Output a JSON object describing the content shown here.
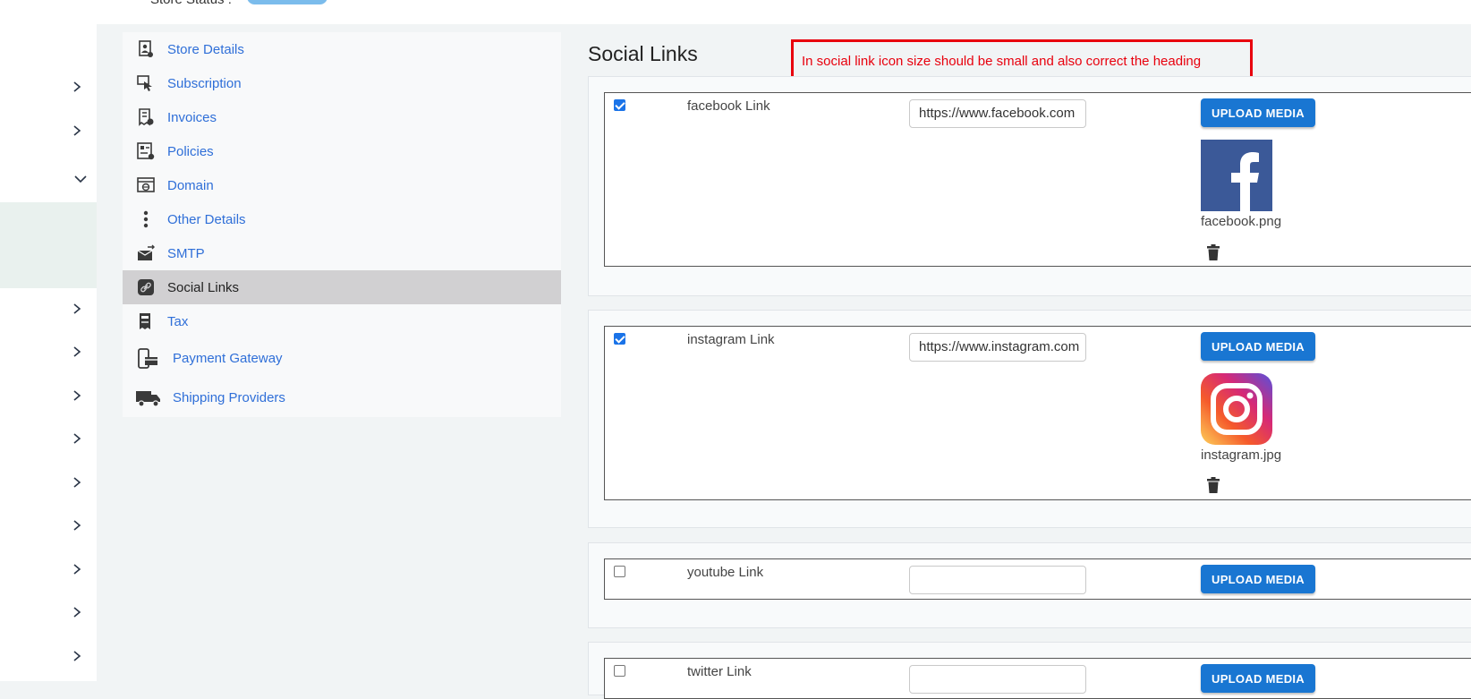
{
  "header": {
    "store_status_label": "Store Status :"
  },
  "settings_menu": {
    "items": [
      {
        "label": "Store Details",
        "icon": "store-details-icon",
        "active": false
      },
      {
        "label": "Subscription",
        "icon": "subscription-icon",
        "active": false
      },
      {
        "label": "Invoices",
        "icon": "invoices-icon",
        "active": false
      },
      {
        "label": "Policies",
        "icon": "policies-icon",
        "active": false
      },
      {
        "label": "Domain",
        "icon": "domain-icon",
        "active": false
      },
      {
        "label": "Other Details",
        "icon": "more-vertical-icon",
        "active": false
      },
      {
        "label": "SMTP",
        "icon": "smtp-mail-icon",
        "active": false
      },
      {
        "label": "Social Links",
        "icon": "link-icon",
        "active": true
      },
      {
        "label": "Tax",
        "icon": "tax-receipt-icon",
        "active": false
      },
      {
        "label": "Payment Gateway",
        "icon": "payment-gateway-icon",
        "active": false
      },
      {
        "label": "Shipping Providers",
        "icon": "shipping-truck-icon",
        "active": false
      }
    ]
  },
  "main": {
    "title": "Social Links",
    "annotation": "In social link icon size should be small and also correct the heading",
    "upload_button_label": "UPLOAD MEDIA",
    "social_links": [
      {
        "label": "facebook Link",
        "checked": true,
        "url": "https://www.facebook.com",
        "media_file": "facebook.png"
      },
      {
        "label": "instagram Link",
        "checked": true,
        "url": "https://www.instagram.com",
        "media_file": "instagram.jpg"
      },
      {
        "label": "youtube Link",
        "checked": false,
        "url": "",
        "media_file": ""
      },
      {
        "label": "twitter Link",
        "checked": false,
        "url": "",
        "media_file": ""
      }
    ]
  },
  "colors": {
    "accent": "#1976d2",
    "link_text": "#2f6fd8",
    "annotation_red": "#e8000d",
    "active_menu_bg": "#d1d0d2"
  }
}
